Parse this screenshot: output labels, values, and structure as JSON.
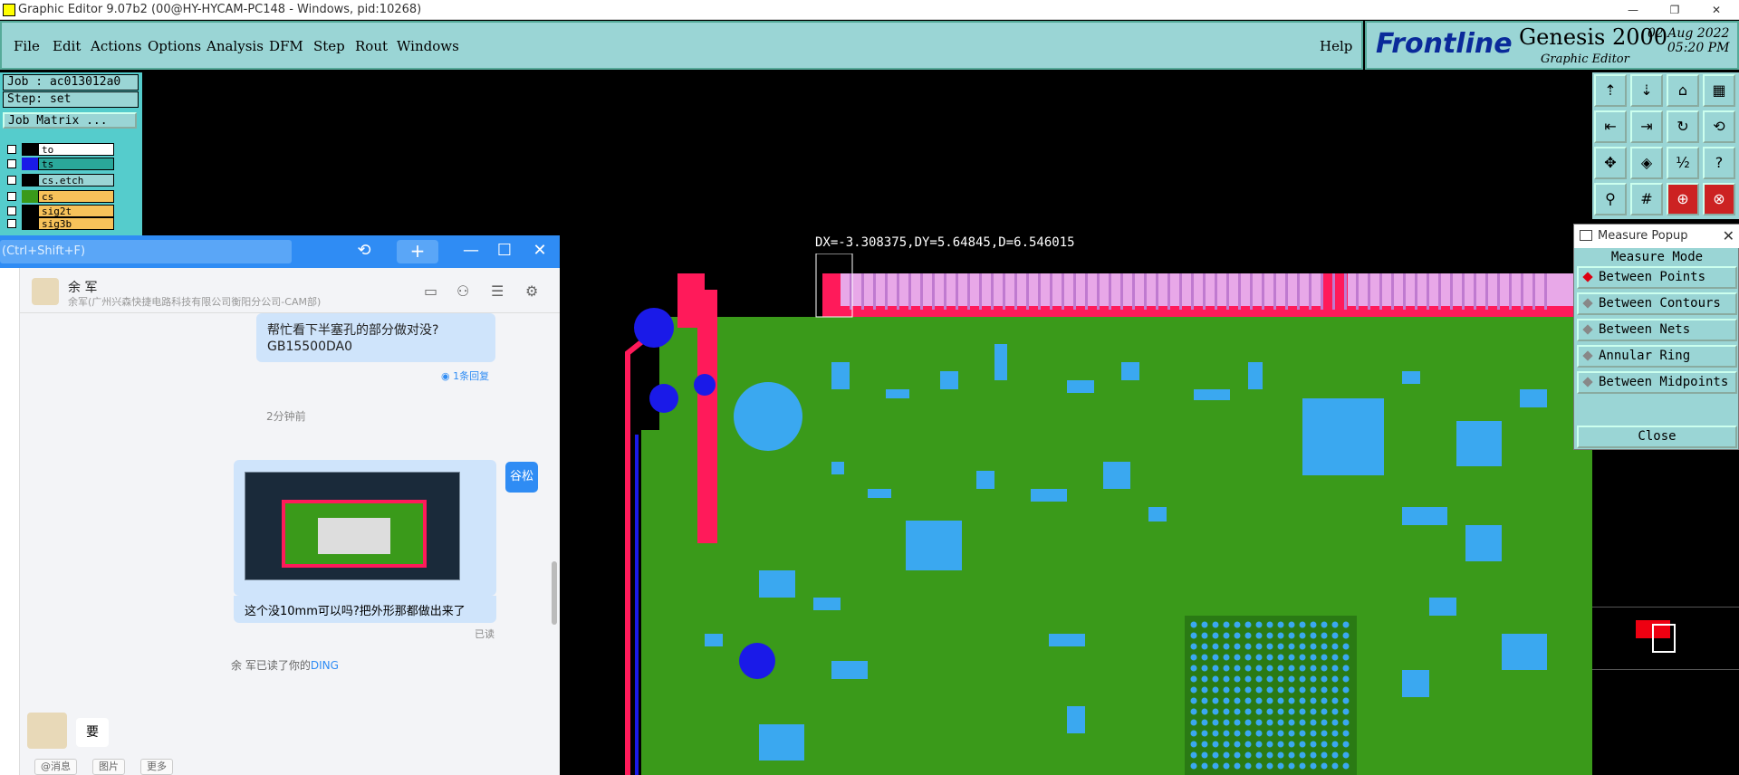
{
  "titlebar": {
    "text": "Graphic Editor 9.07b2 (00@HY-HYCAM-PC148 - Windows, pid:10268)"
  },
  "menu": [
    "File",
    "Edit",
    "Actions",
    "Options",
    "Analysis",
    "DFM",
    "Step",
    "Rout",
    "Windows"
  ],
  "help": "Help",
  "brand": {
    "logo": "Frontline",
    "product": "Genesis 2000",
    "subtitle": "Graphic Editor",
    "date": "02 Aug 2022",
    "time": "05:20 PM"
  },
  "job": {
    "job": "Job : ac013012a0",
    "step": "Step: set",
    "matrix": "Job Matrix ..."
  },
  "layers": [
    {
      "name": "to",
      "color": "#000000",
      "fill": "#ffffff"
    },
    {
      "name": "ts",
      "color": "#1a1ae8",
      "fill": "#2aa89a"
    },
    {
      "name": "cs.etch",
      "color": "#000000",
      "fill": "#9ad5d5"
    },
    {
      "name": "cs",
      "color": "#3a9a1a",
      "fill": "#f7c25a"
    },
    {
      "name": "sig2t",
      "color": "#000000",
      "fill": "#f7c25a"
    },
    {
      "name": "sig3b",
      "color": "#000000",
      "fill": "#f7c25a"
    }
  ],
  "measure_label": "DX=-3.308375,DY=5.64845,D=6.546015",
  "measure_popup": {
    "title": "Measure Popup",
    "mode_label": "Measure Mode",
    "options": [
      "Between Points",
      "Between Contours",
      "Between Nets",
      "Annular Ring",
      "Between Midpoints"
    ],
    "selected": 0,
    "close": "Close"
  },
  "chat": {
    "search_placeholder": "(Ctrl+Shift+F)",
    "contact_name": "余 军",
    "contact_org": "余军(广州兴森快捷电路科技有限公司衡阳分公司-CAM部)",
    "msg1_line1": "帮忙看下半塞孔的部分做对没?",
    "msg1_line2": "GB15500DA0",
    "reply_count": "1条回复",
    "time_sep": "2分钟前",
    "my_name_badge": "谷松",
    "msg2_text": "这个没10mm可以吗?把外形那都做出来了",
    "read_status": "已读",
    "ding_prefix": "余 军已读了你的",
    "ding": "DING",
    "incoming": "要",
    "input_chips": [
      "@消息",
      "图片",
      "更多"
    ]
  },
  "colors": {
    "accent": "#2f8cf4",
    "panel": "#9ad5d5",
    "copper": "#3a9a1a",
    "pad": "#3aa8f0",
    "mask": "#ff1a5a"
  }
}
